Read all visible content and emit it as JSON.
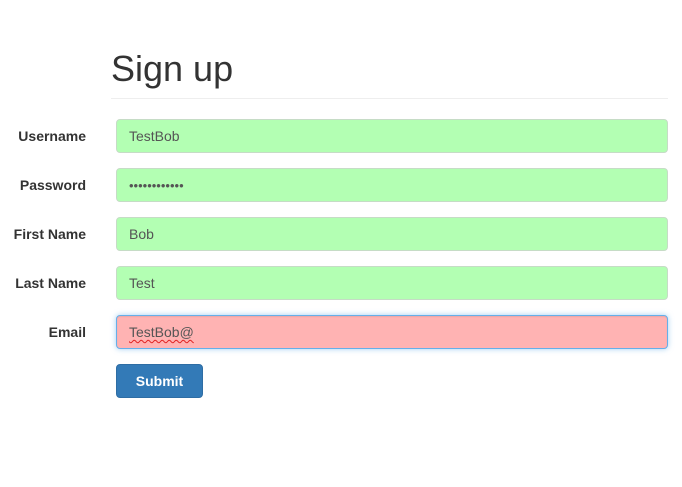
{
  "page": {
    "title": "Sign up"
  },
  "form": {
    "fields": [
      {
        "label": "Username",
        "value": "TestBob",
        "status": "valid"
      },
      {
        "label": "Password",
        "value": "••••••••••••",
        "status": "valid"
      },
      {
        "label": "First Name",
        "value": "Bob",
        "status": "valid"
      },
      {
        "label": "Last Name",
        "value": "Test",
        "status": "valid"
      },
      {
        "label": "Email",
        "value": "TestBob@",
        "status": "invalid"
      }
    ],
    "submit_label": "Submit"
  },
  "colors": {
    "valid_bg": "#b3ffb3",
    "invalid_bg": "#ffb3b3",
    "primary_button": "#337ab7"
  }
}
